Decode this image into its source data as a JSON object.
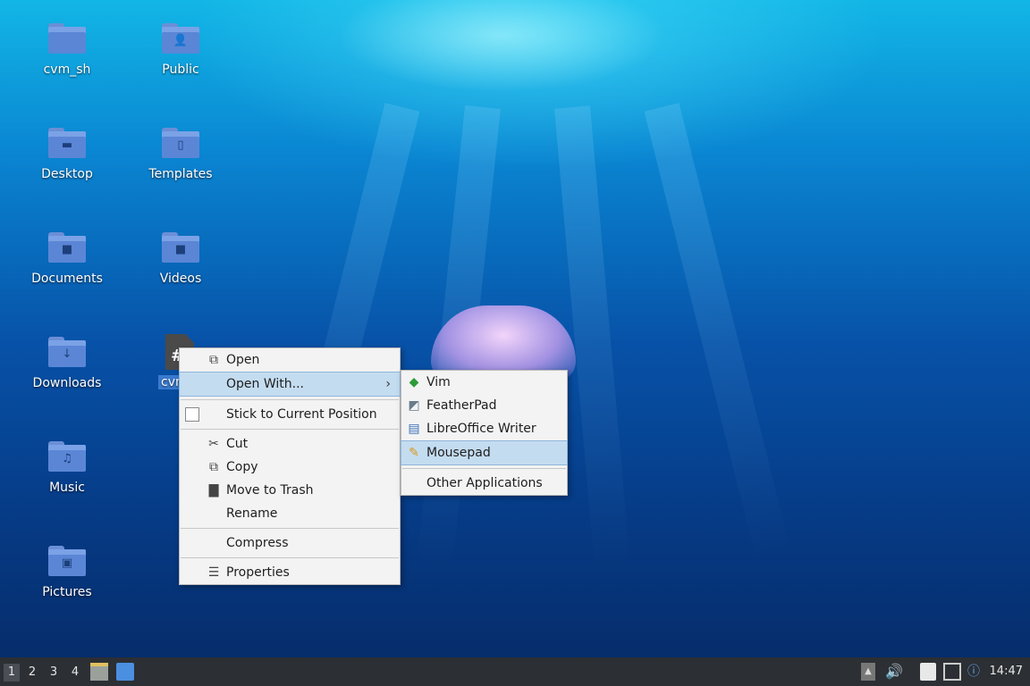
{
  "desktop": {
    "icons": [
      {
        "label": "cvm_sh",
        "glyph": ""
      },
      {
        "label": "Public",
        "glyph": "👤"
      },
      {
        "label": "Desktop",
        "glyph": "▬"
      },
      {
        "label": "Templates",
        "glyph": "▯"
      },
      {
        "label": "Documents",
        "glyph": "■"
      },
      {
        "label": "Videos",
        "glyph": "■"
      },
      {
        "label": "Downloads",
        "glyph": "↓"
      },
      {
        "label": "Music",
        "glyph": "♫"
      },
      {
        "label": "Pictures",
        "glyph": "▣"
      }
    ],
    "selected_file": {
      "label": "cvm",
      "glyph": "#"
    }
  },
  "context_menu": {
    "open": "Open",
    "open_with": "Open With...",
    "stick": "Stick to Current Position",
    "cut": "Cut",
    "copy": "Copy",
    "trash": "Move to Trash",
    "rename": "Rename",
    "compress": "Compress",
    "properties": "Properties",
    "icons": {
      "open": "open-icon",
      "cut": "scissors-icon",
      "copy": "copy-icon",
      "trash": "trash-icon",
      "properties": "list-icon"
    }
  },
  "submenu": {
    "vim": "Vim",
    "featherpad": "FeatherPad",
    "libreoffice": "LibreOffice Writer",
    "mousepad": "Mousepad",
    "other": "Other Applications"
  },
  "taskbar": {
    "workspaces": [
      "1",
      "2",
      "3",
      "4"
    ],
    "active_workspace": "1",
    "clock": "14:47"
  },
  "colors": {
    "highlight": "#c4dcf0",
    "taskbar": "#2c2f33",
    "folder": "#5b86d6"
  }
}
